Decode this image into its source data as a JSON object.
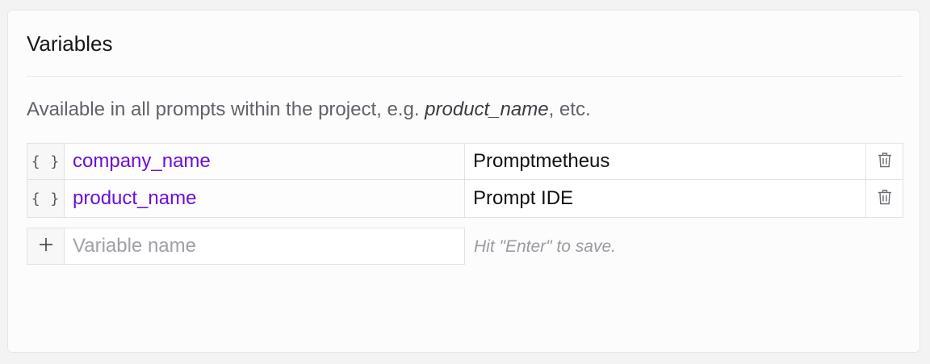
{
  "panel": {
    "title": "Variables",
    "description": {
      "prefix": "Available in all prompts within the project, e.g. ",
      "example": "product_name",
      "suffix": ", etc."
    }
  },
  "variables": [
    {
      "icon": "braces-icon",
      "brace_text": "{ }",
      "name": "company_name",
      "value": "Promptmetheus",
      "delete_icon": "trash-icon"
    },
    {
      "icon": "braces-icon",
      "brace_text": "{ }",
      "name": "product_name",
      "value": "Prompt IDE",
      "delete_icon": "trash-icon"
    }
  ],
  "new_variable": {
    "icon": "plus-icon",
    "placeholder": "Variable name",
    "value": "",
    "hint": "Hit \"Enter\" to save."
  },
  "colors": {
    "variable_name": "#6b0fd8",
    "muted_text": "#62626a",
    "placeholder": "#a0a0a8"
  }
}
